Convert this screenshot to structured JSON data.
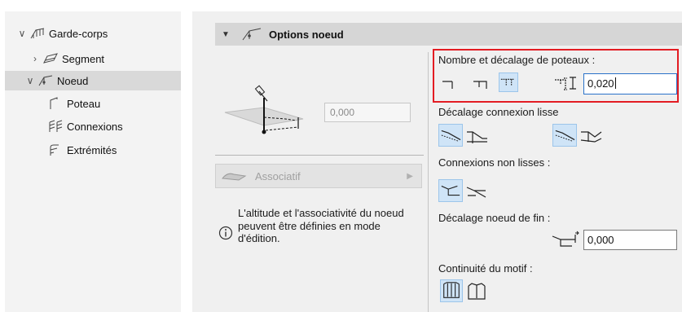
{
  "tree": {
    "items": [
      {
        "label": "Garde-corps"
      },
      {
        "label": "Segment"
      },
      {
        "label": "Noeud"
      },
      {
        "label": "Poteau"
      },
      {
        "label": "Connexions"
      },
      {
        "label": "Extrémités"
      }
    ]
  },
  "panel": {
    "title": "Options noeud",
    "altitude_value": "0,000",
    "associatif_label": "Associatif",
    "info_text": "L'altitude et l'associativité du noeud peuvent être définies en mode d'édition."
  },
  "right": {
    "post_label": "Nombre et décalage de poteaux :",
    "post_offset_value": "0,020",
    "smooth_label": "Décalage connexion lisse",
    "nonsmooth_label": "Connexions non lisses :",
    "end_label": "Décalage noeud de fin :",
    "end_value": "0,000",
    "pattern_label": "Continuité du motif :"
  },
  "colors": {
    "highlight": "#e31c23",
    "selected_button": "#cfe4f7",
    "input_focus": "#2a72c9"
  }
}
